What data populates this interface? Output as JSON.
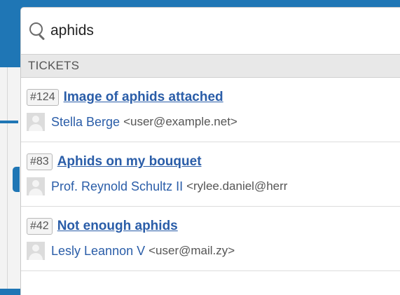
{
  "search": {
    "value": "aphids",
    "placeholder": ""
  },
  "section": {
    "title": "TICKETS"
  },
  "tickets": [
    {
      "number": "#124",
      "title": "Image of aphids attached",
      "requester_name": "Stella Berge",
      "requester_email": "<user@example.net>"
    },
    {
      "number": "#83",
      "title": "Aphids on my bouquet",
      "requester_name": "Prof. Reynold Schultz II",
      "requester_email": "<rylee.daniel@herr"
    },
    {
      "number": "#42",
      "title": "Not enough aphids",
      "requester_name": "Lesly Leannon V",
      "requester_email": "<user@mail.zy>"
    }
  ],
  "colors": {
    "brand": "#1f76b5",
    "link": "#2a5da8",
    "header_bg": "#e8e8e8"
  },
  "icons": {
    "search": "search-icon",
    "avatar": "avatar-placeholder-icon"
  }
}
